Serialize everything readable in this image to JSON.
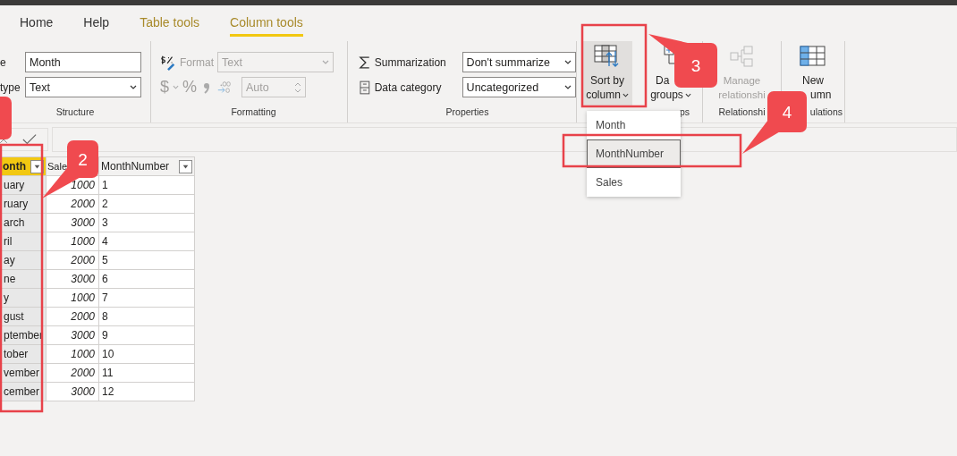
{
  "tabs": [
    {
      "label": "Home",
      "selected": false,
      "kind": "standard"
    },
    {
      "label": "Help",
      "selected": false,
      "kind": "standard"
    },
    {
      "label": "Table tools",
      "selected": false,
      "kind": "contextual"
    },
    {
      "label": "Column tools",
      "selected": true,
      "kind": "contextual"
    }
  ],
  "structure": {
    "name_label": "e",
    "name_value": "Month",
    "type_label": "type",
    "type_value": "Text",
    "group": "Structure"
  },
  "formatting": {
    "format_label": "Format",
    "format_value": "Text",
    "currency": "$",
    "percent": "%",
    "decimals": "Auto",
    "disabled": true,
    "group": "Formatting"
  },
  "properties": {
    "summarization_label": "Summarization",
    "summarization_value": "Don't summarize",
    "category_label": "Data category",
    "category_value": "Uncategorized",
    "group": "Properties"
  },
  "buttons": [
    {
      "kind": "sort",
      "lines": [
        "Sort by",
        "column"
      ],
      "dropdown": true,
      "pressed": true,
      "disabled": false
    },
    {
      "kind": "groups",
      "lines": [
        "Da",
        "groups"
      ],
      "dropdown": true,
      "pressed": false,
      "disabled": false
    },
    {
      "kind": "relationships",
      "lines": [
        "Manage",
        "relationshi"
      ],
      "dropdown": false,
      "pressed": false,
      "disabled": true
    },
    {
      "kind": "new_column",
      "lines": [
        "New",
        "umn"
      ],
      "dropdown": false,
      "pressed": false,
      "disabled": false
    }
  ],
  "group_labels": [
    "ps",
    "Relationshi",
    "ulations"
  ],
  "table": {
    "columns": [
      {
        "label": "onth",
        "selected": true
      },
      {
        "label": "Sale",
        "selected": false
      },
      {
        "label": "MonthNumber",
        "selected": false
      }
    ],
    "rows": [
      [
        "uary",
        "1000",
        "1"
      ],
      [
        "ruary",
        "2000",
        "2"
      ],
      [
        "arch",
        "3000",
        "3"
      ],
      [
        "ril",
        "1000",
        "4"
      ],
      [
        "ay",
        "2000",
        "5"
      ],
      [
        "ne",
        "3000",
        "6"
      ],
      [
        "y",
        "1000",
        "7"
      ],
      [
        "gust",
        "2000",
        "8"
      ],
      [
        "ptember",
        "3000",
        "9"
      ],
      [
        "tober",
        "1000",
        "10"
      ],
      [
        "vember",
        "2000",
        "11"
      ],
      [
        "cember",
        "3000",
        "12"
      ]
    ]
  },
  "menu": {
    "items": [
      {
        "label": "Month",
        "selected": false
      },
      {
        "label": "MonthNumber",
        "selected": true
      },
      {
        "label": "Sales",
        "selected": false
      }
    ]
  },
  "callouts": [
    "2",
    "3",
    "4"
  ]
}
